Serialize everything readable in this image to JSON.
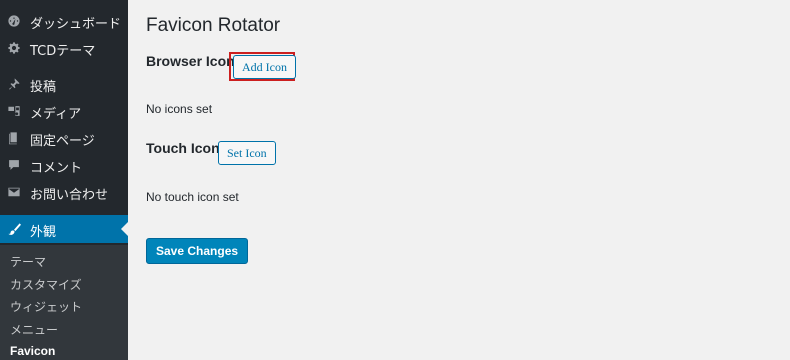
{
  "sidebar": {
    "items": [
      {
        "label": "ダッシュボード",
        "icon": "dashboard-icon"
      },
      {
        "label": "TCDテーマ",
        "icon": "gear-icon"
      },
      {
        "label": "投稿",
        "icon": "pin-icon"
      },
      {
        "label": "メディア",
        "icon": "media-icon"
      },
      {
        "label": "固定ページ",
        "icon": "page-icon"
      },
      {
        "label": "コメント",
        "icon": "comment-icon"
      },
      {
        "label": "お問い合わせ",
        "icon": "mail-icon"
      },
      {
        "label": "外観",
        "icon": "paintbrush-icon",
        "active": true
      }
    ],
    "submenu": [
      {
        "label": "テーマ"
      },
      {
        "label": "カスタマイズ"
      },
      {
        "label": "ウィジェット"
      },
      {
        "label": "メニュー"
      },
      {
        "label": "Favicon",
        "current": true
      }
    ]
  },
  "main": {
    "title": "Favicon Rotator",
    "browser_icon": {
      "heading": "Browser Icon",
      "button": "Add Icon",
      "status": "No icons set"
    },
    "touch_icon": {
      "heading": "Touch Icon",
      "button": "Set Icon",
      "status": "No touch icon set"
    },
    "save_button": "Save Changes"
  },
  "colors": {
    "sidebar_bg": "#23282d",
    "submenu_bg": "#32373c",
    "accent": "#0073aa",
    "primary_button": "#0085ba",
    "highlight": "#cc1f1f",
    "page_bg": "#f1f1f1"
  }
}
